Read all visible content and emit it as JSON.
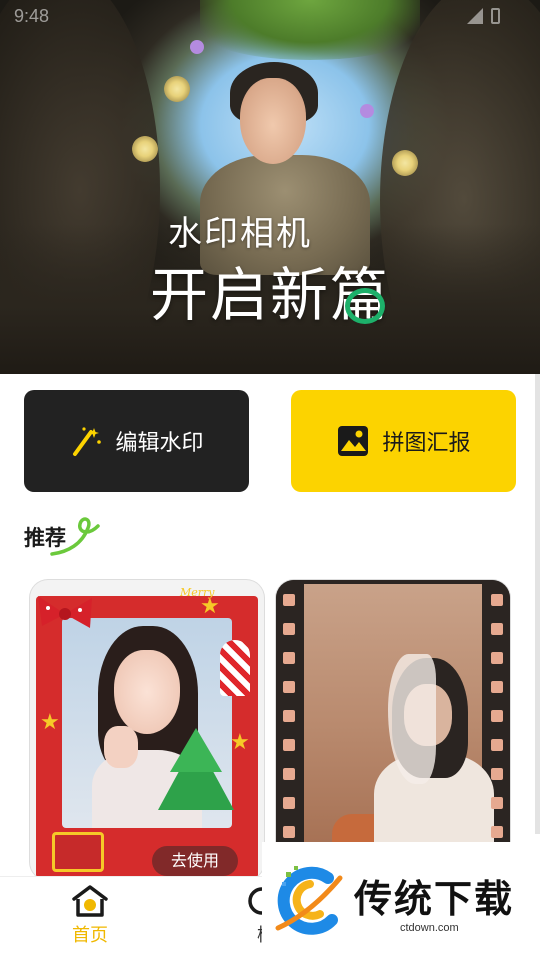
{
  "status_bar": {
    "time": "9:48"
  },
  "hero": {
    "title_line1": "水印相机",
    "title_line2": "开启新篇"
  },
  "actions": {
    "edit_watermark": "编辑水印",
    "collage_report": "拼图汇报"
  },
  "section": {
    "title": "推荐"
  },
  "cards": [
    {
      "name": "christmas-template",
      "banner": "Merry",
      "cta": "去使用"
    },
    {
      "name": "film-template"
    }
  ],
  "bottom_nav": [
    {
      "label": "首页",
      "active": true
    },
    {
      "label": "模",
      "active": false
    }
  ],
  "watermark": {
    "brand": "传统下载",
    "domain": "ctdown.com"
  },
  "colors": {
    "accent_yellow": "#fcd300",
    "dark_button": "#222222",
    "nav_active": "#f0b800",
    "section_deco_green": "#6bc93c"
  }
}
